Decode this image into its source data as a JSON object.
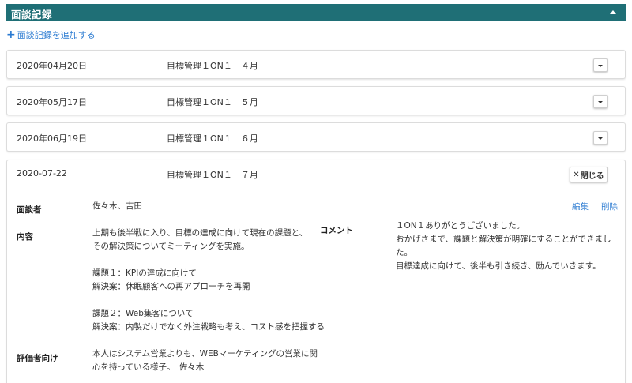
{
  "section": {
    "title": "面談記録",
    "collapse_icon": "caret-up-icon"
  },
  "add_link": {
    "icon": "plus-icon",
    "label": "面談記録を追加する"
  },
  "records": [
    {
      "date": "2020年04月20日",
      "title": "目標管理１ON１　４月"
    },
    {
      "date": "2020年05月17日",
      "title": "目標管理１ON１　５月"
    },
    {
      "date": "2020年06月19日",
      "title": "目標管理１ON１　６月"
    }
  ],
  "expanded": {
    "date": "2020-07-22",
    "title": "目標管理１ON１　７月",
    "close_label": "閉じる",
    "interviewer_label": "面談者",
    "interviewer": "佐々木、吉田",
    "edit_label": "編集",
    "delete_label": "削除",
    "content_label": "内容",
    "content_lines": [
      "上期も後半戦に入り、目標の達成に向けて現在の課題と、",
      "その解決策についてミーティングを実施。",
      "",
      "課題１：KPIの達成に向けて",
      "解決案：休眠顧客への再アプローチを再開",
      "",
      "課題２：Web集客について",
      "解決案：内製だけでなく外注戦略も考え、コスト感を把握する"
    ],
    "comment_label": "コメント",
    "comment_lines": [
      "１ON１ありがとうございました。",
      "おかげさまで、課題と解決策が明確にすることができました。",
      "目標達成に向けて、後半も引き続き、励んでいきます。"
    ],
    "evaluator_label": "評価者向け",
    "evaluator_lines": [
      "本人はシステム営業よりも、WEBマーケティングの営業に関",
      "心を持っている様子。　佐々木"
    ]
  }
}
